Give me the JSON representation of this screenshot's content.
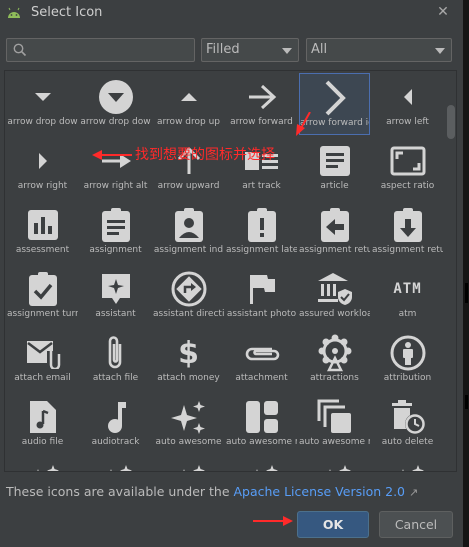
{
  "window": {
    "title": "Select Icon"
  },
  "search": {
    "placeholder": ""
  },
  "filters": {
    "style": "Filled",
    "category": "All"
  },
  "icons": [
    {
      "label": "arrow drop dow",
      "icon": "arrow-drop-down-icon"
    },
    {
      "label": "arrow drop dow",
      "icon": "arrow-drop-down-circle-icon"
    },
    {
      "label": "arrow drop up",
      "icon": "arrow-drop-up-icon"
    },
    {
      "label": "arrow forward",
      "icon": "arrow-forward-icon"
    },
    {
      "label": "arrow forward io",
      "icon": "arrow-forward-ios-icon",
      "selected": true
    },
    {
      "label": "arrow left",
      "icon": "arrow-left-icon"
    },
    {
      "label": "arrow right",
      "icon": "arrow-right-icon"
    },
    {
      "label": "arrow right alt",
      "icon": "arrow-right-alt-icon"
    },
    {
      "label": "arrow upward",
      "icon": "arrow-upward-icon"
    },
    {
      "label": "art track",
      "icon": "art-track-icon"
    },
    {
      "label": "article",
      "icon": "article-icon"
    },
    {
      "label": "aspect ratio",
      "icon": "aspect-ratio-icon"
    },
    {
      "label": "assessment",
      "icon": "assessment-icon"
    },
    {
      "label": "assignment",
      "icon": "assignment-icon"
    },
    {
      "label": "assignment ind",
      "icon": "assignment-ind-icon"
    },
    {
      "label": "assignment late",
      "icon": "assignment-late-icon"
    },
    {
      "label": "assignment retur",
      "icon": "assignment-return-icon"
    },
    {
      "label": "assignment retur",
      "icon": "assignment-returned-icon"
    },
    {
      "label": "assignment turn",
      "icon": "assignment-turned-in-icon"
    },
    {
      "label": "assistant",
      "icon": "assistant-icon"
    },
    {
      "label": "assistant directio",
      "icon": "assistant-direction-icon"
    },
    {
      "label": "assistant photo",
      "icon": "assistant-photo-icon"
    },
    {
      "label": "assured workloa",
      "icon": "assured-workload-icon"
    },
    {
      "label": "atm",
      "icon": "atm-icon"
    },
    {
      "label": "attach email",
      "icon": "attach-email-icon"
    },
    {
      "label": "attach file",
      "icon": "attach-file-icon"
    },
    {
      "label": "attach money",
      "icon": "attach-money-icon"
    },
    {
      "label": "attachment",
      "icon": "attachment-icon"
    },
    {
      "label": "attractions",
      "icon": "attractions-icon"
    },
    {
      "label": "attribution",
      "icon": "attribution-icon"
    },
    {
      "label": "audio file",
      "icon": "audio-file-icon"
    },
    {
      "label": "audiotrack",
      "icon": "audiotrack-icon"
    },
    {
      "label": "auto awesome",
      "icon": "auto-awesome-icon"
    },
    {
      "label": "auto awesome m",
      "icon": "auto-awesome-mosaic-icon"
    },
    {
      "label": "auto awesome m",
      "icon": "auto-awesome-motion-icon"
    },
    {
      "label": "auto delete",
      "icon": "auto-delete-icon"
    }
  ],
  "annotation": {
    "text": "找到想要的图标并选择"
  },
  "footer": {
    "prefix": "These icons are available under the ",
    "link": "Apache License Version 2.0",
    "ext_icon": "↗"
  },
  "buttons": {
    "ok": "OK",
    "cancel": "Cancel"
  },
  "colors": {
    "accent": "#365880",
    "link": "#589df6",
    "annotation": "#ff2a2a"
  }
}
